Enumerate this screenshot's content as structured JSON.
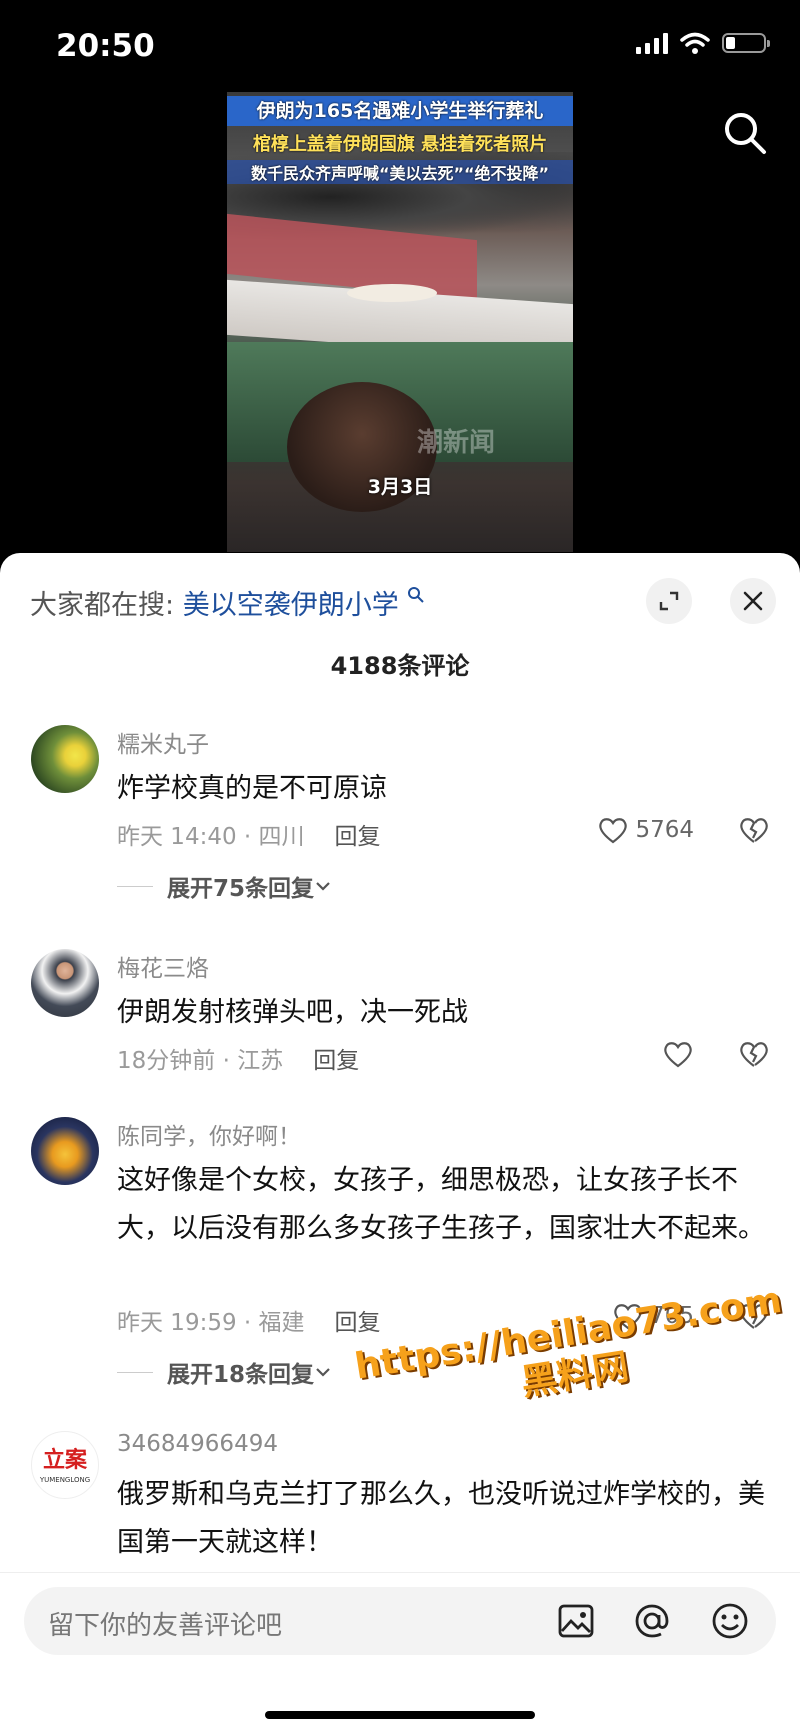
{
  "status": {
    "time": "20:50"
  },
  "video": {
    "caption1": "伊朗为165名遇难小学生举行葬礼",
    "caption2": "棺椁上盖着伊朗国旗 悬挂着死者照片",
    "caption3": "数千民众齐声呼喊“美以去死”“绝不投降”",
    "date": "3月3日",
    "watermark": "潮新闻"
  },
  "sheet": {
    "hot_search_label": "大家都在搜:",
    "hot_search_query": "美以空袭伊朗小学",
    "comment_count": "4188条评论"
  },
  "comments": [
    {
      "user": "糯米丸子",
      "text": "炸学校真的是不可原谅",
      "time": "昨天 14:40 · 四川",
      "reply": "回复",
      "likes": "5764",
      "expand": "展开75条回复"
    },
    {
      "user": "梅花三烙",
      "text": "伊朗发射核弹头吧，决一死战",
      "time": "18分钟前 · 江苏",
      "reply": "回复",
      "likes": ""
    },
    {
      "user": "陈同学，你好啊！",
      "text": "这好像是个女校，女孩子，细思极恐，让女孩子长不大，以后没有那么多女孩子生孩子，国家壮大不起来。",
      "time": "昨天 19:59 · 福建",
      "reply": "回复",
      "likes": "705",
      "expand": "展开18条回复"
    },
    {
      "user": "34684966494",
      "text": "俄罗斯和乌克兰打了那么久，也没听说过炸学校的，美国第一天就这样！",
      "avatar_text": "立案",
      "avatar_sub": "YUMENGLONG"
    }
  ],
  "overlay_watermark": {
    "line1": "https://heiliao73.com",
    "line2": "黑料网"
  },
  "input": {
    "placeholder": "留下你的友善评论吧"
  },
  "icons": [
    "signal-icon",
    "wifi-icon",
    "battery-icon",
    "search-icon",
    "expand-icon",
    "close-icon",
    "heart-icon",
    "broken-heart-icon",
    "image-icon",
    "at-icon",
    "emoji-icon",
    "chevron-down-icon"
  ]
}
